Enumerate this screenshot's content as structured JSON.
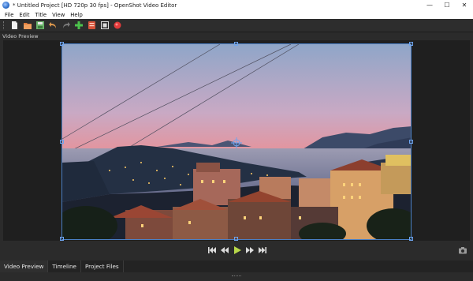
{
  "window": {
    "title": "* Untitled Project [HD 720p 30 fps] - OpenShot Video Editor",
    "minimize_symbol": "—",
    "maximize_symbol": "☐",
    "close_symbol": "✕"
  },
  "menu": [
    "File",
    "Edit",
    "Title",
    "View",
    "Help"
  ],
  "toolbar": {
    "buttons": [
      {
        "name": "new-project",
        "icon": "new-file-icon",
        "color": "#f2f2f2"
      },
      {
        "name": "open-project",
        "icon": "open-folder-icon",
        "color": "#e07a3a"
      },
      {
        "name": "save-project",
        "icon": "save-icon",
        "color": "#69b26a"
      },
      {
        "name": "undo",
        "icon": "undo-icon",
        "color": "#e29b4d"
      },
      {
        "name": "redo",
        "icon": "redo-icon",
        "color": "#7c7c7c"
      },
      {
        "name": "import-files",
        "icon": "plus-icon",
        "color": "#4cc24c"
      },
      {
        "name": "choose-profile",
        "icon": "profile-icon",
        "color": "#d6533a"
      },
      {
        "name": "fullscreen",
        "icon": "fullscreen-icon",
        "color": "#dddddd"
      },
      {
        "name": "export-video",
        "icon": "record-icon",
        "color": "#e23b3b"
      }
    ]
  },
  "preview": {
    "dock_title": "Video Preview",
    "accent": "#4a7fc4"
  },
  "playback": {
    "buttons": [
      "jump-start",
      "rewind",
      "play",
      "fast-forward",
      "jump-end"
    ],
    "play_color": "#b8d84a"
  },
  "tabs": [
    {
      "label": "Video Preview",
      "active": true
    },
    {
      "label": "Timeline",
      "active": false
    },
    {
      "label": "Project Files",
      "active": false
    }
  ]
}
